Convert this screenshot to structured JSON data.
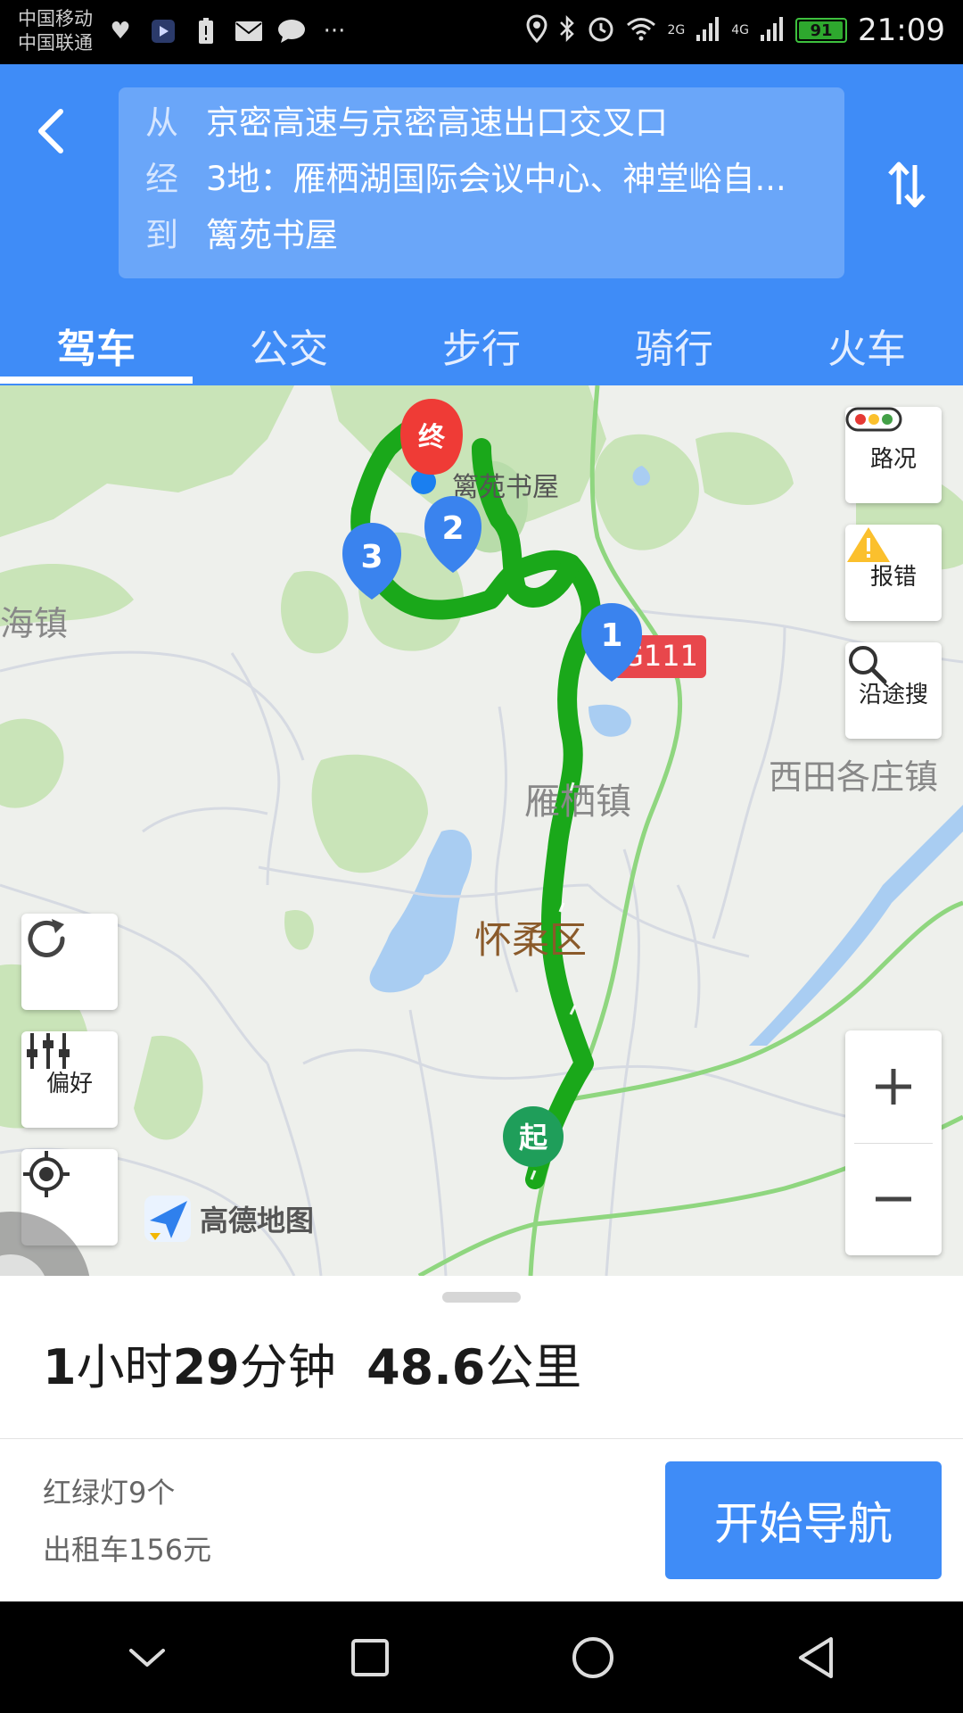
{
  "status_bar": {
    "carrier1": "中国移动",
    "carrier2": "中国联通",
    "net1": "2G",
    "net2": "4G",
    "battery": "91",
    "battery_level": 0.91,
    "time": "21:09"
  },
  "route": {
    "from_key": "从",
    "from": "京密高速与京密高速出口交叉口",
    "via_key": "经",
    "via": "3地：雁栖湖国际会议中心、神堂峪自...",
    "to_key": "到",
    "to": "篱苑书屋"
  },
  "tabs": [
    "驾车",
    "公交",
    "步行",
    "骑行",
    "火车"
  ],
  "active_tab": 0,
  "map": {
    "end_marker": "终",
    "start_marker": "起",
    "waypoints": [
      "1",
      "2",
      "3"
    ],
    "labels": {
      "dest": "篱苑书屋",
      "town1": "海镇",
      "town2": "西田各庄镇",
      "town3": "雁栖镇",
      "district": "怀柔区",
      "highway": "G111"
    },
    "buttons": {
      "traffic": "路况",
      "report": "报错",
      "search_along": "沿途搜",
      "preference": "偏好"
    },
    "logo": "高德地图",
    "route_color": "#1aa81a",
    "water_color": "#a9cdf2",
    "park_color": "#c8e6b8"
  },
  "summary": {
    "hours": "1",
    "hour_unit": "小时",
    "minutes": "29",
    "minute_unit": "分钟",
    "distance": "48.6",
    "distance_unit": "公里"
  },
  "details": {
    "traffic_lights": "红绿灯9个",
    "taxi": "出租车156元"
  },
  "start_button": "开始导航",
  "colors": {
    "header_blue": "#3f8cf7",
    "route_box_blue": "#6aa6f9"
  }
}
